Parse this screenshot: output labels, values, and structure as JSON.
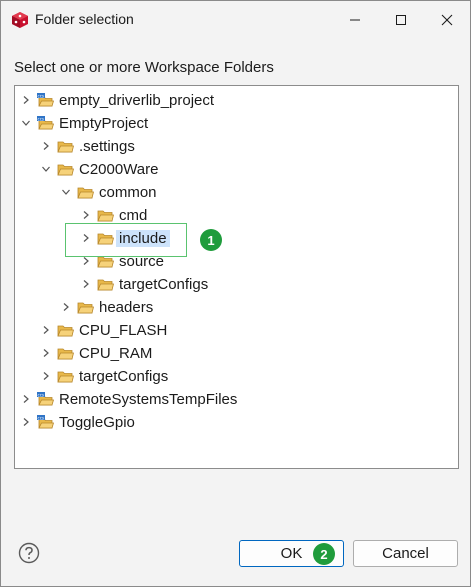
{
  "window": {
    "title": "Folder selection"
  },
  "instruction": "Select one or more Workspace Folders",
  "tree": [
    {
      "label": "empty_driverlib_project",
      "expanded": false,
      "kind": "project",
      "level": 0
    },
    {
      "label": "EmptyProject",
      "expanded": true,
      "kind": "project",
      "level": 0
    },
    {
      "label": ".settings",
      "expanded": false,
      "kind": "folder",
      "level": 1
    },
    {
      "label": "C2000Ware",
      "expanded": true,
      "kind": "folder",
      "level": 1
    },
    {
      "label": "common",
      "expanded": true,
      "kind": "folder",
      "level": 2
    },
    {
      "label": "cmd",
      "expanded": false,
      "kind": "folder",
      "level": 3
    },
    {
      "label": "include",
      "expanded": false,
      "kind": "folder",
      "level": 3,
      "selected": true
    },
    {
      "label": "source",
      "expanded": false,
      "kind": "folder",
      "level": 3
    },
    {
      "label": "targetConfigs",
      "expanded": false,
      "kind": "folder",
      "level": 3
    },
    {
      "label": "headers",
      "expanded": false,
      "kind": "folder",
      "level": 2
    },
    {
      "label": "CPU_FLASH",
      "expanded": false,
      "kind": "folder",
      "level": 1
    },
    {
      "label": "CPU_RAM",
      "expanded": false,
      "kind": "folder",
      "level": 1
    },
    {
      "label": "targetConfigs",
      "expanded": false,
      "kind": "folder",
      "level": 1
    },
    {
      "label": "RemoteSystemsTempFiles",
      "expanded": false,
      "kind": "project",
      "level": 0
    },
    {
      "label": "ToggleGpio",
      "expanded": false,
      "kind": "project",
      "level": 0
    }
  ],
  "annotations": {
    "badge1": "1",
    "badge2": "2"
  },
  "buttons": {
    "ok": "OK",
    "cancel": "Cancel"
  },
  "colors": {
    "selection": "#cde3fb",
    "annotation": "#1f9c3c",
    "folder": "#e8b84a"
  }
}
